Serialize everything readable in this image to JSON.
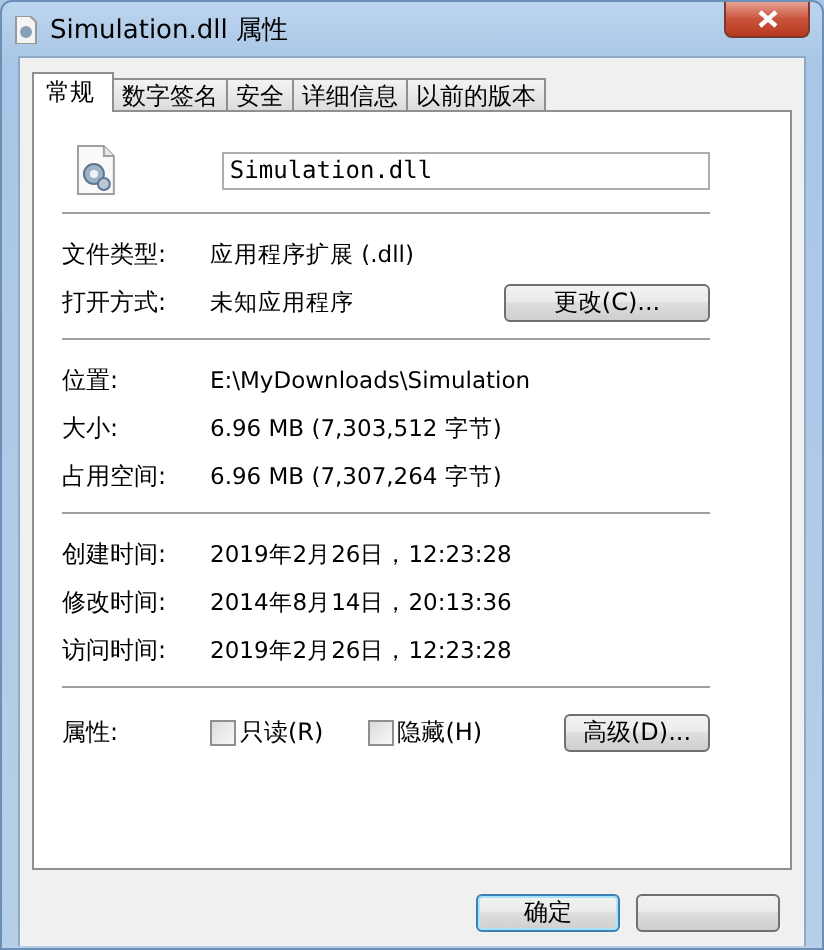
{
  "window": {
    "title": "Simulation.dll 属性"
  },
  "tabs": [
    {
      "label": "常规",
      "selected": true
    },
    {
      "label": "数字签名",
      "selected": false
    },
    {
      "label": "安全",
      "selected": false
    },
    {
      "label": "详细信息",
      "selected": false
    },
    {
      "label": "以前的版本",
      "selected": false
    }
  ],
  "file_name": {
    "value": "Simulation.dll"
  },
  "sections": [
    [
      {
        "label": "文件类型:",
        "value": "应用程序扩展 (.dll)"
      },
      {
        "label": "打开方式:",
        "value": "未知应用程序",
        "button": "更改(C)..."
      }
    ],
    [
      {
        "label": "位置:",
        "value": "E:\\MyDownloads\\Simulation"
      },
      {
        "label": "大小:",
        "value": "6.96 MB (7,303,512 字节)"
      },
      {
        "label": "占用空间:",
        "value": "6.96 MB (7,307,264 字节)"
      }
    ],
    [
      {
        "label": "创建时间:",
        "value": "2019年2月26日，12:23:28"
      },
      {
        "label": "修改时间:",
        "value": "2014年8月14日，20:13:36"
      },
      {
        "label": "访问时间:",
        "value": "2019年2月26日，12:23:28"
      }
    ]
  ],
  "attributes": {
    "label": "属性:",
    "checkboxes": [
      {
        "label": "只读(R)",
        "checked": false
      },
      {
        "label": "隐藏(H)",
        "checked": false
      }
    ],
    "button": "高级(D)..."
  },
  "footer_buttons": [
    {
      "label": "确定",
      "focused": true
    },
    {
      "focused": false
    }
  ]
}
